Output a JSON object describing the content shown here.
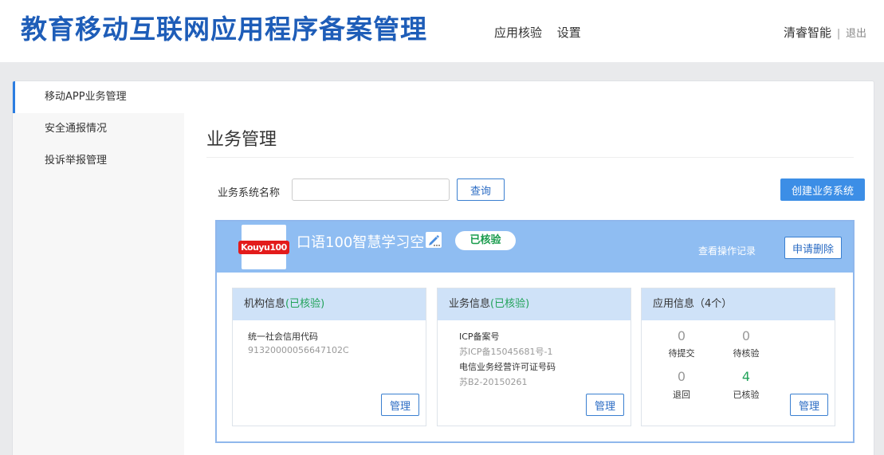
{
  "header": {
    "brand": "教育移动互联网应用程序备案管理",
    "nav": [
      "应用核验",
      "设置"
    ],
    "user_name": "清睿智能",
    "separator": "|",
    "logout": "退出"
  },
  "sidebar": {
    "items": [
      {
        "label": "移动APP业务管理",
        "active": true
      },
      {
        "label": "安全通报情况",
        "active": false
      },
      {
        "label": "投诉举报管理",
        "active": false
      }
    ]
  },
  "main": {
    "title": "业务管理",
    "search": {
      "label": "业务系统名称",
      "value": "",
      "placeholder": ""
    },
    "query_button": "查询",
    "create_button": "创建业务系统"
  },
  "app": {
    "logo_text": "Kouyu100",
    "name": "口语100智慧学习空",
    "status": "已核验",
    "oplog_link": "查看操作记录",
    "delete_button": "申请删除",
    "org": {
      "title": "机构信息",
      "status": "(已核验)",
      "credit_label": "统一社会信用代码",
      "credit_value": "91320000056647102C",
      "manage": "管理"
    },
    "biz": {
      "title": "业务信息",
      "status": "(已核验)",
      "icp_label": "ICP备案号",
      "icp_value": "苏ICP备15045681号-1",
      "license_label": "电信业务经营许可证号码",
      "license_value": "苏B2-20150261",
      "manage": "管理"
    },
    "appinfo": {
      "title": "应用信息（4个）",
      "stats": [
        {
          "value": "0",
          "label": "待提交"
        },
        {
          "value": "0",
          "label": "待核验"
        },
        {
          "value": "0",
          "label": "退回"
        },
        {
          "value": "4",
          "label": "已核验"
        }
      ],
      "manage": "管理"
    }
  },
  "colors": {
    "brand_blue": "#1e5db8",
    "card_header": "#8fbdf2",
    "status_green": "#22a35a"
  }
}
